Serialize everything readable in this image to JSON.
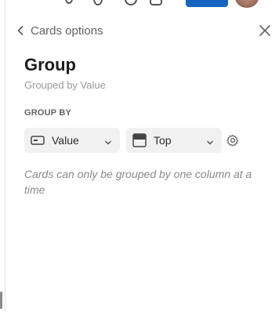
{
  "header": {
    "back_label": "Cards options",
    "back_icon": "chevron-left-icon",
    "close_icon": "close-icon"
  },
  "panel": {
    "title": "Group",
    "subtitle": "Grouped by Value",
    "section_label": "GROUP BY",
    "group_select": {
      "value": "Value",
      "icon": "card-field-icon"
    },
    "position_select": {
      "value": "Top",
      "icon": "layout-top-icon"
    },
    "settings_icon": "gear-icon",
    "note": "Cards can only be grouped by one column at a time"
  },
  "colors": {
    "accent": "#1565c0",
    "select_bg": "#f1f1f1",
    "muted_text": "#8a8a8a"
  }
}
